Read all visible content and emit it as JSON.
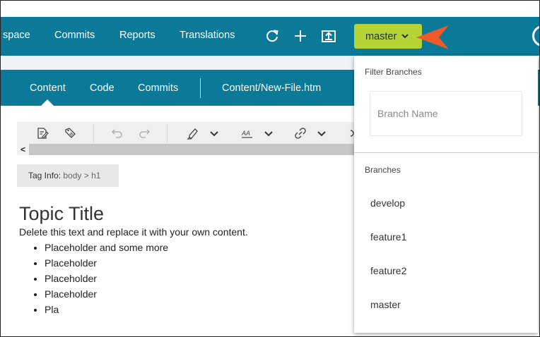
{
  "top_nav": {
    "items": [
      {
        "label": "space"
      },
      {
        "label": "Commits"
      },
      {
        "label": "Reports"
      },
      {
        "label": "Translations"
      }
    ],
    "icons": [
      "refresh-icon",
      "plus-icon",
      "upload-icon"
    ]
  },
  "branch_button": {
    "label": "master"
  },
  "sub_nav": {
    "items": [
      {
        "label": "Content"
      },
      {
        "label": "Code"
      },
      {
        "label": "Commits"
      }
    ],
    "active": "Content",
    "file_path": "Content/New-File.htm"
  },
  "tag_info": {
    "label": "Tag Info:",
    "path": "body > h1"
  },
  "document": {
    "title": "Topic Title",
    "paragraph": "Delete this text and replace it with your own content.",
    "list": [
      "Placeholder and some more",
      "Placeholder",
      "Placeholder",
      "Placeholder",
      "Pla"
    ]
  },
  "branch_dropdown": {
    "filter_label": "Filter Branches",
    "input_placeholder": "Branch Name",
    "branches_label": "Branches",
    "branches": [
      "develop",
      "feature1",
      "feature2",
      "master"
    ]
  },
  "colors": {
    "nav_bg": "#0b7a99",
    "branch_button_bg": "#b5d334",
    "pointer": "#f05a28"
  }
}
